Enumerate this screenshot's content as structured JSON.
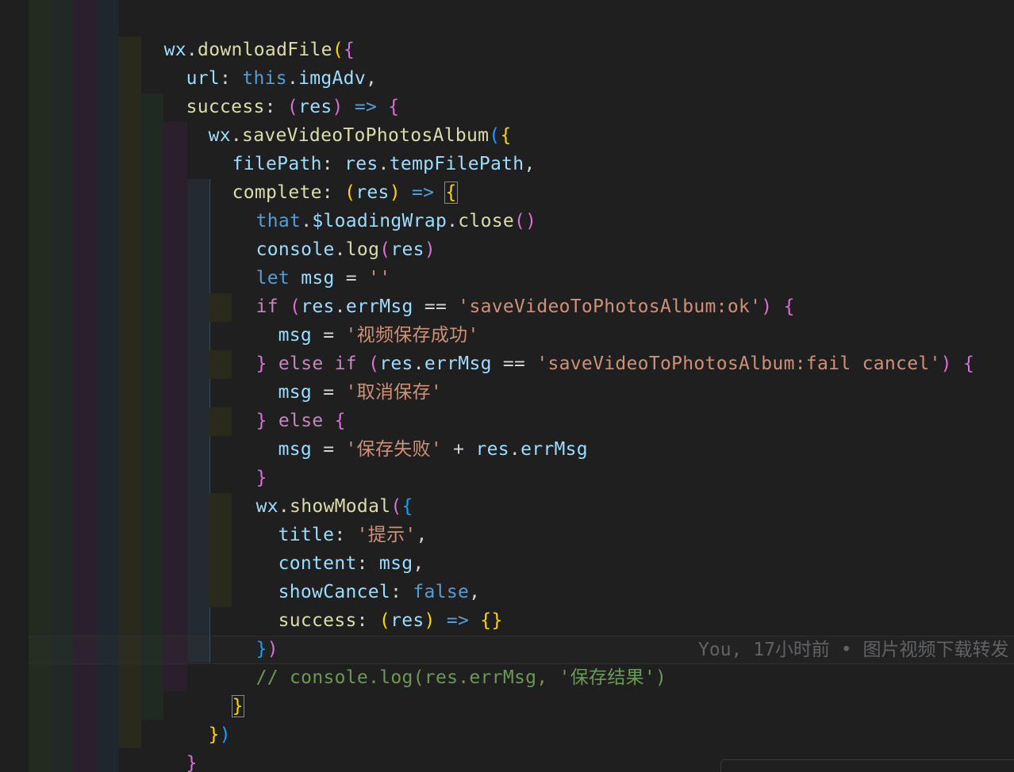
{
  "editor": {
    "lines": [
      {
        "text": "wx.downloadFile({"
      },
      {
        "text": "url: this.imgAdv,"
      },
      {
        "text": "success: (res) => {"
      },
      {
        "text": "wx.saveVideoToPhotosAlbum({"
      },
      {
        "text": "filePath: res.tempFilePath,"
      },
      {
        "text": "complete: (res) => {"
      },
      {
        "text": "that.$loadingWrap.close()"
      },
      {
        "text": "console.log(res)"
      },
      {
        "text": "let msg = ''"
      },
      {
        "text": "if (res.errMsg == 'saveVideoToPhotosAlbum:ok') {"
      },
      {
        "text": "msg = '视频保存成功'"
      },
      {
        "text": "} else if (res.errMsg == 'saveVideoToPhotosAlbum:fail cancel') {"
      },
      {
        "text": "msg = '取消保存'"
      },
      {
        "text": "} else {"
      },
      {
        "text": "msg = '保存失败' + res.errMsg"
      },
      {
        "text": "}"
      },
      {
        "text": "wx.showModal({"
      },
      {
        "text": "title: '提示',"
      },
      {
        "text": "content: msg,"
      },
      {
        "text": "showCancel: false,"
      },
      {
        "text": "success: (res) => {}"
      },
      {
        "text": "})"
      },
      {
        "text": "// console.log(res.errMsg, '保存结果')"
      },
      {
        "text": "}"
      },
      {
        "text": "})"
      },
      {
        "text": "}"
      },
      {
        "text": "})"
      }
    ],
    "blame": "You, 17小时前 • 图片视频下载转发"
  }
}
